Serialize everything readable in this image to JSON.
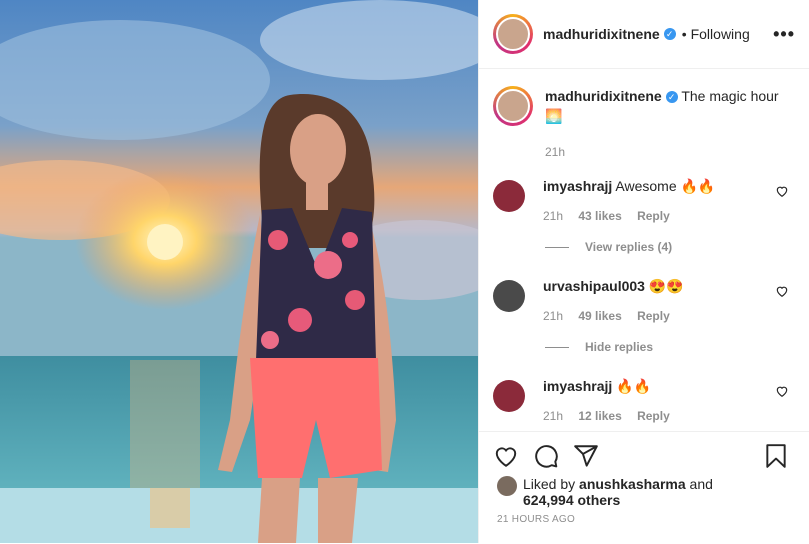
{
  "header": {
    "username": "madhuridixitnene",
    "verified_badge": "✓",
    "separator": "•",
    "follow_status": "Following",
    "more_label": "•••"
  },
  "caption": {
    "username": "madhuridixitnene",
    "text": "The magic hour",
    "emoji": "🌅",
    "time": "21h"
  },
  "comments": [
    {
      "username": "imyashrajj",
      "text": "Awesome 🔥🔥",
      "time": "21h",
      "likes": "43 likes",
      "reply": "Reply",
      "thread": "View replies (4)"
    },
    {
      "username": "urvashipaul003",
      "text": "😍😍",
      "time": "21h",
      "likes": "49 likes",
      "reply": "Reply",
      "thread": "Hide replies"
    },
    {
      "username": "imyashrajj",
      "text": "🔥🔥",
      "time": "21h",
      "likes": "12 likes",
      "reply": "Reply"
    }
  ],
  "liked_by": {
    "prefix": "Liked by",
    "user": "anushkasharma",
    "and": "and",
    "count": "624,994 others"
  },
  "posted_ago": "21 HOURS AGO",
  "icons": [
    "heart-icon",
    "comment-icon",
    "share-icon",
    "bookmark-icon",
    "more-icon"
  ],
  "colors": {
    "verified": "#3897f0",
    "muted": "#8e8e8e",
    "text": "#262626"
  }
}
